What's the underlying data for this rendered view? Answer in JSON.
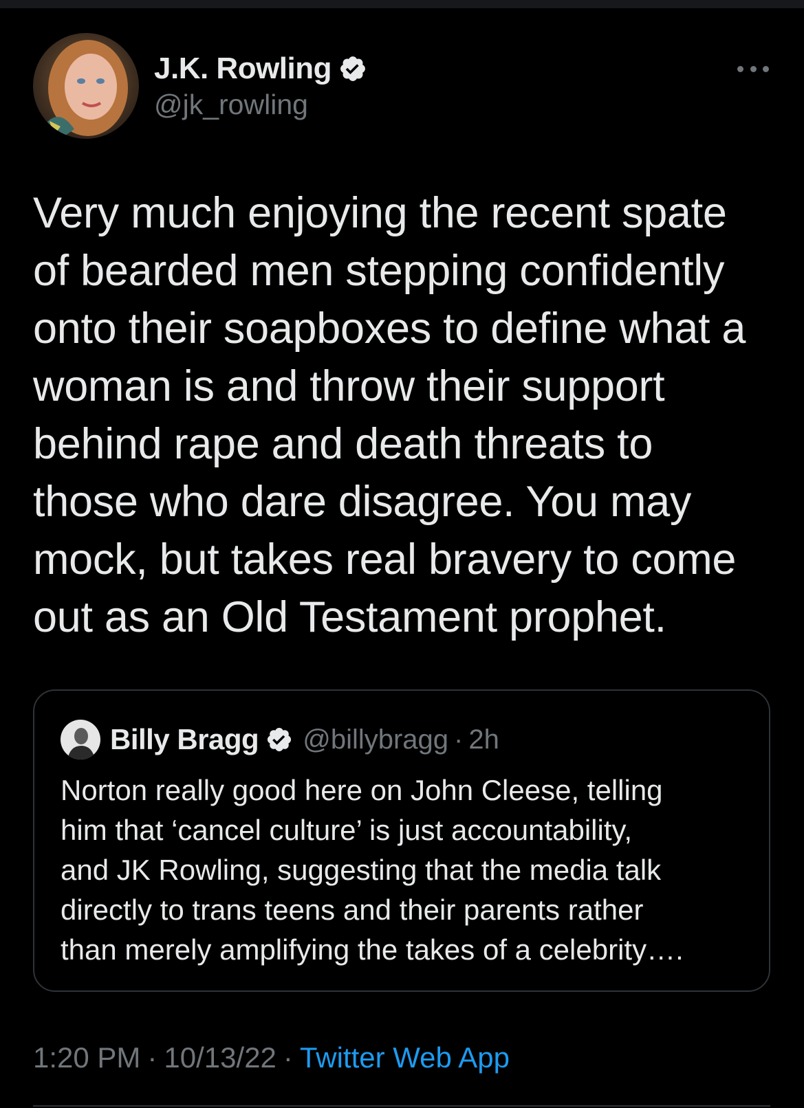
{
  "colors": {
    "background": "#000000",
    "primary_text": "#e7e9ea",
    "secondary_text": "#71767b",
    "link": "#1d9bf0",
    "border": "#2f3336"
  },
  "tweet": {
    "author": {
      "display_name": "J.K. Rowling",
      "handle": "@jk_rowling",
      "verified": true,
      "avatar_icon": "profile-photo"
    },
    "menu_icon": "more-horizontal-icon",
    "text": "Very much enjoying the recent spate\nof bearded men stepping confidently\nonto their soapboxes to define what a\nwoman is and throw their support\nbehind rape and death threats to\nthose who dare disagree. You may\nmock, but takes real bravery to come\nout as an Old Testament prophet.",
    "quoted": {
      "display_name": "Billy Bragg",
      "handle": "@billybragg",
      "separator": "·",
      "time": "2h",
      "verified": true,
      "text": "Norton really good here on John Cleese, telling\nhim that ‘cancel culture’ is just accountability,\nand JK Rowling, suggesting that the media talk\ndirectly to trans teens and their parents rather\nthan merely amplifying the takes of a celebrity…."
    },
    "meta": {
      "time": "1:20 PM",
      "separator": "·",
      "date": "10/13/22",
      "source": "Twitter Web App"
    }
  }
}
